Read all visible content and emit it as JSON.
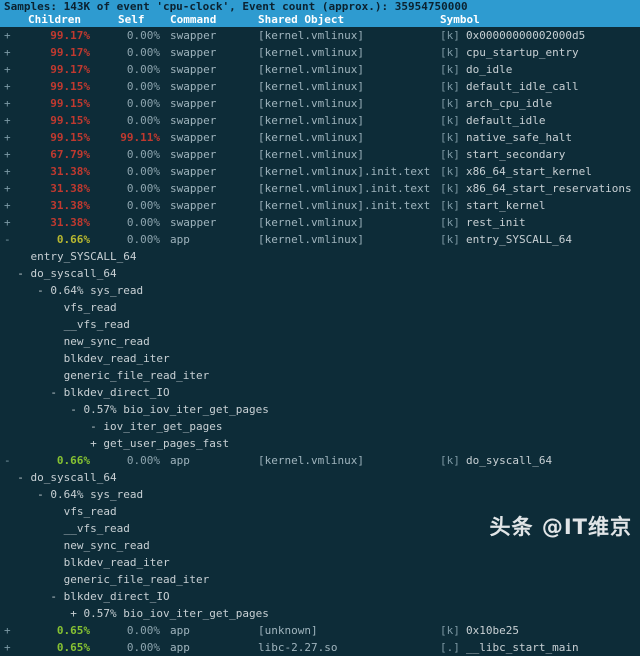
{
  "header": {
    "summary": "Samples: 143K of event 'cpu-clock', Event count (approx.): 35954750000",
    "columns": {
      "children": "Children",
      "self": "Self",
      "command": "Command",
      "shared_object": "Shared Object",
      "symbol": "Symbol"
    }
  },
  "colors": {
    "background": "#0d2c38",
    "header_bar": "#2e9bd0",
    "header_text": "#0b2230",
    "column_text": "#ffffff",
    "pct_high": "#c0392f",
    "pct_olive": "#b8b830",
    "pct_low": "#86c232",
    "text": "#c8d0d4"
  },
  "rows": [
    {
      "kind": "entry",
      "expander": "+",
      "children": "99.17%",
      "children_color": "red",
      "self": "0.00%",
      "self_color": "dim",
      "command": "swapper",
      "dso": "[kernel.vmlinux]",
      "kmark": "[k]",
      "symbol": "0x00000000002000d5"
    },
    {
      "kind": "entry",
      "expander": "+",
      "children": "99.17%",
      "children_color": "red",
      "self": "0.00%",
      "self_color": "dim",
      "command": "swapper",
      "dso": "[kernel.vmlinux]",
      "kmark": "[k]",
      "symbol": "cpu_startup_entry"
    },
    {
      "kind": "entry",
      "expander": "+",
      "children": "99.17%",
      "children_color": "red",
      "self": "0.00%",
      "self_color": "dim",
      "command": "swapper",
      "dso": "[kernel.vmlinux]",
      "kmark": "[k]",
      "symbol": "do_idle"
    },
    {
      "kind": "entry",
      "expander": "+",
      "children": "99.15%",
      "children_color": "red",
      "self": "0.00%",
      "self_color": "dim",
      "command": "swapper",
      "dso": "[kernel.vmlinux]",
      "kmark": "[k]",
      "symbol": "default_idle_call"
    },
    {
      "kind": "entry",
      "expander": "+",
      "children": "99.15%",
      "children_color": "red",
      "self": "0.00%",
      "self_color": "dim",
      "command": "swapper",
      "dso": "[kernel.vmlinux]",
      "kmark": "[k]",
      "symbol": "arch_cpu_idle"
    },
    {
      "kind": "entry",
      "expander": "+",
      "children": "99.15%",
      "children_color": "red",
      "self": "0.00%",
      "self_color": "dim",
      "command": "swapper",
      "dso": "[kernel.vmlinux]",
      "kmark": "[k]",
      "symbol": "default_idle"
    },
    {
      "kind": "entry",
      "expander": "+",
      "children": "99.15%",
      "children_color": "red",
      "self": "99.11%",
      "self_color": "red",
      "command": "swapper",
      "dso": "[kernel.vmlinux]",
      "kmark": "[k]",
      "symbol": "native_safe_halt"
    },
    {
      "kind": "entry",
      "expander": "+",
      "children": "67.79%",
      "children_color": "red",
      "self": "0.00%",
      "self_color": "dim",
      "command": "swapper",
      "dso": "[kernel.vmlinux]",
      "kmark": "[k]",
      "symbol": "start_secondary"
    },
    {
      "kind": "entry",
      "expander": "+",
      "children": "31.38%",
      "children_color": "red",
      "self": "0.00%",
      "self_color": "dim",
      "command": "swapper",
      "dso": "[kernel.vmlinux].init.text",
      "kmark": "[k]",
      "symbol": "x86_64_start_kernel"
    },
    {
      "kind": "entry",
      "expander": "+",
      "children": "31.38%",
      "children_color": "red",
      "self": "0.00%",
      "self_color": "dim",
      "command": "swapper",
      "dso": "[kernel.vmlinux].init.text",
      "kmark": "[k]",
      "symbol": "x86_64_start_reservations"
    },
    {
      "kind": "entry",
      "expander": "+",
      "children": "31.38%",
      "children_color": "red",
      "self": "0.00%",
      "self_color": "dim",
      "command": "swapper",
      "dso": "[kernel.vmlinux].init.text",
      "kmark": "[k]",
      "symbol": "start_kernel"
    },
    {
      "kind": "entry",
      "expander": "+",
      "children": "31.38%",
      "children_color": "red",
      "self": "0.00%",
      "self_color": "dim",
      "command": "swapper",
      "dso": "[kernel.vmlinux]",
      "kmark": "[k]",
      "symbol": "rest_init"
    },
    {
      "kind": "entry",
      "expander": "-",
      "children": "0.66%",
      "children_color": "olive",
      "self": "0.00%",
      "self_color": "dim",
      "command": "app",
      "dso": "[kernel.vmlinux]",
      "kmark": "[k]",
      "symbol": "entry_SYSCALL_64"
    },
    {
      "kind": "chain",
      "text": "    entry_SYSCALL_64"
    },
    {
      "kind": "chain",
      "text": "  - do_syscall_64"
    },
    {
      "kind": "chain",
      "text": "     - 0.64% sys_read"
    },
    {
      "kind": "chain",
      "text": "         vfs_read"
    },
    {
      "kind": "chain",
      "text": "         __vfs_read"
    },
    {
      "kind": "chain",
      "text": "         new_sync_read"
    },
    {
      "kind": "chain",
      "text": "         blkdev_read_iter"
    },
    {
      "kind": "chain",
      "text": "         generic_file_read_iter"
    },
    {
      "kind": "chain",
      "text": "       - blkdev_direct_IO"
    },
    {
      "kind": "chain",
      "text": "          - 0.57% bio_iov_iter_get_pages"
    },
    {
      "kind": "chain",
      "text": "             - iov_iter_get_pages"
    },
    {
      "kind": "chain",
      "text": "             + get_user_pages_fast"
    },
    {
      "kind": "entry",
      "expander": "-",
      "children": "0.66%",
      "children_color": "green",
      "self": "0.00%",
      "self_color": "dim",
      "command": "app",
      "dso": "[kernel.vmlinux]",
      "kmark": "[k]",
      "symbol": "do_syscall_64"
    },
    {
      "kind": "chain",
      "text": "  - do_syscall_64"
    },
    {
      "kind": "chain",
      "text": "     - 0.64% sys_read"
    },
    {
      "kind": "chain",
      "text": "         vfs_read"
    },
    {
      "kind": "chain",
      "text": "         __vfs_read"
    },
    {
      "kind": "chain",
      "text": "         new_sync_read"
    },
    {
      "kind": "chain",
      "text": "         blkdev_read_iter"
    },
    {
      "kind": "chain",
      "text": "         generic_file_read_iter"
    },
    {
      "kind": "chain",
      "text": "       - blkdev_direct_IO"
    },
    {
      "kind": "chain",
      "text": "          + 0.57% bio_iov_iter_get_pages"
    },
    {
      "kind": "entry",
      "expander": "+",
      "children": "0.65%",
      "children_color": "green",
      "self": "0.00%",
      "self_color": "dim",
      "command": "app",
      "dso": "[unknown]",
      "kmark": "[k]",
      "symbol": "0x10be25"
    },
    {
      "kind": "entry",
      "expander": "+",
      "children": "0.65%",
      "children_color": "green",
      "self": "0.00%",
      "self_color": "dim",
      "command": "app",
      "dso": "libc-2.27.so",
      "kmark": "[.]",
      "symbol": "__libc_start_main"
    }
  ],
  "watermark": {
    "text": "头条 @IT维京"
  }
}
